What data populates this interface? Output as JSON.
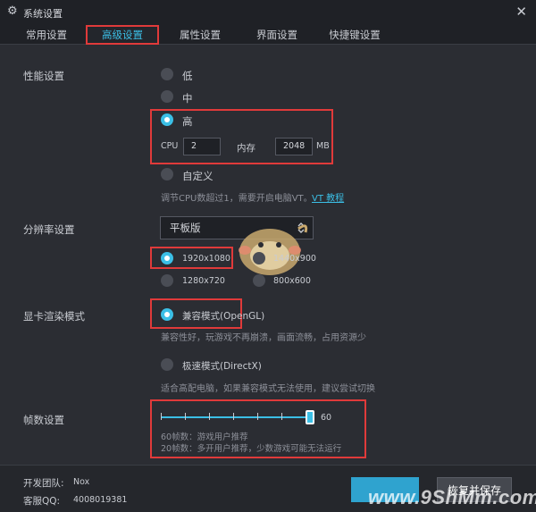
{
  "window": {
    "title": "系统设置"
  },
  "tabs": [
    {
      "label": "常用设置"
    },
    {
      "label": "高级设置"
    },
    {
      "label": "属性设置"
    },
    {
      "label": "界面设置"
    },
    {
      "label": "快捷键设置"
    }
  ],
  "performance": {
    "label": "性能设置",
    "options": {
      "low": "低",
      "mid": "中",
      "high": "高",
      "custom": "自定义"
    },
    "selected": "高",
    "cpu_label": "CPU",
    "cpu_value": "2",
    "mem_label": "内存",
    "mem_value": "2048",
    "mem_unit": "MB",
    "hint": "调节CPU数超过1，需要开启电脑VT。",
    "vt_link": "VT 教程"
  },
  "resolution": {
    "label": "分辨率设置",
    "mode_value": "平板版",
    "options": [
      "1920x1080",
      "1440x900",
      "1280x720",
      "800x600"
    ],
    "selected": "1920x1080"
  },
  "render": {
    "label": "显卡渲染模式",
    "compat_label": "兼容模式(OpenGL)",
    "compat_hint": "兼容性好，玩游戏不再崩溃，画面流畅，占用资源少",
    "speed_label": "极速模式(DirectX)",
    "speed_hint": "适合高配电脑，如果兼容模式无法使用，建议尝试切换",
    "selected": "兼容模式(OpenGL)"
  },
  "fps": {
    "label": "帧数设置",
    "value": "60",
    "slider_fraction": 1.0,
    "hint1": "60帧数：游戏用户推荐",
    "hint2": "20帧数：多开用户推荐，少数游戏可能无法运行"
  },
  "footer": {
    "team_label": "开发团队:",
    "team_value": "Nox",
    "qq_label": "客服QQ:",
    "qq_value": "4008019381",
    "save_label": "恢复并保存",
    "watermark": "www.9ShMm.com"
  },
  "colors": {
    "accent": "#3bbfe6",
    "highlight_box": "#e03a3a",
    "background": "#2b2d33"
  }
}
